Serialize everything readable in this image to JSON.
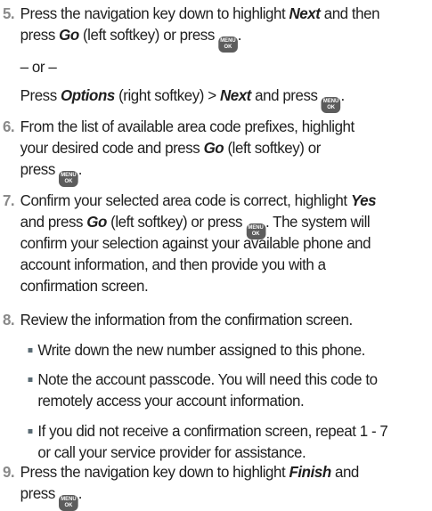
{
  "key_icon": {
    "top": "MENU",
    "bottom": "OK"
  },
  "step5": {
    "num": "5.",
    "l1a": "Press the navigation key down to highlight ",
    "l1b": "Next",
    "l1c": " and then",
    "l2a": "press ",
    "l2b": "Go",
    "l2c": " (left softkey) or press ",
    "l2d": ".",
    "or": "– or –",
    "l3a": "Press ",
    "l3b": "Options",
    "l3c": " (right softkey) > ",
    "l3d": "Next",
    "l3e": " and press ",
    "l3f": "."
  },
  "step6": {
    "num": "6.",
    "l1": "From the list of available area code prefixes, highlight",
    "l2a": "your desired code and press ",
    "l2b": "Go",
    "l2c": " (left softkey) or",
    "l3a": "press ",
    "l3b": "."
  },
  "step7": {
    "num": "7.",
    "l1a": "Confirm your selected area code is correct, highlight ",
    "l1b": "Yes",
    "l2a": "and press ",
    "l2b": "Go",
    "l2c": " (left softkey) or press ",
    "l2d": ". The system will",
    "l3": "confirm your selection against your available phone and",
    "l4": "account information, and then provide you with a",
    "l5": "confirmation screen."
  },
  "step8": {
    "num": "8.",
    "l1": "Review the information from the confirmation screen.",
    "b1": "Write down the new number assigned to this phone.",
    "b2a": "Note the account passcode. You will need this code to",
    "b2b": "remotely access your account information.",
    "b3a": "If you did not receive a confirmation screen, repeat 1 - 7",
    "b3b": "or call your service provider for assistance."
  },
  "step9": {
    "num": "9.",
    "l1a": "Press the navigation key down to highlight ",
    "l1b": "Finish",
    "l1c": " and",
    "l2a": "press ",
    "l2b": "."
  }
}
